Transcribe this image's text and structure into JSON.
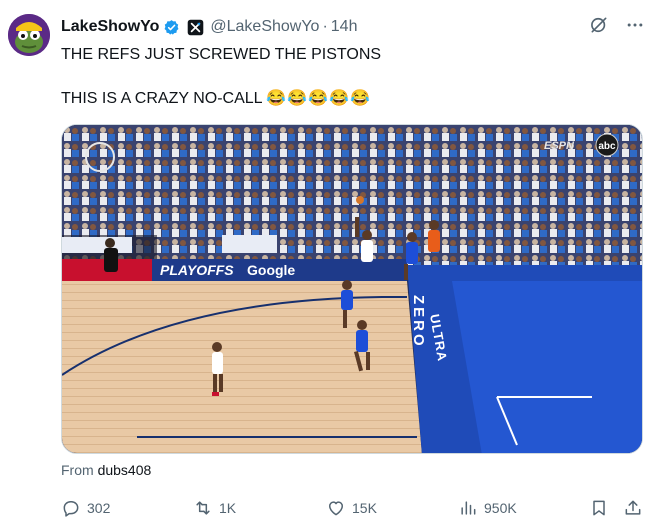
{
  "author": {
    "display_name": "LakeShowYo",
    "handle": "@LakeShowYo",
    "separator": "·",
    "time": "14h",
    "avatar_icon": "frog-avatar-icon",
    "verified_color": "#1d9bf0"
  },
  "tweet": {
    "line1": "THE REFS JUST SCREWED THE PISTONS",
    "line2": "THIS IS A CRAZY NO-CALL",
    "emojis": "😂😂😂😂😂"
  },
  "media": {
    "board_brand": "Google",
    "board_playoffs": "PLAYOFFS",
    "floor_text": "ZERO",
    "floor_text2": "ULTRA",
    "broadcaster1": "ESPN",
    "broadcaster2": "abc"
  },
  "attribution": {
    "prefix": "From ",
    "source": "dubs408"
  },
  "actions": {
    "replies": "302",
    "reposts": "1K",
    "likes": "15K",
    "views": "950K"
  },
  "colors": {
    "accent": "#1d9bf0",
    "muted": "#536471",
    "text": "#0f1419"
  }
}
